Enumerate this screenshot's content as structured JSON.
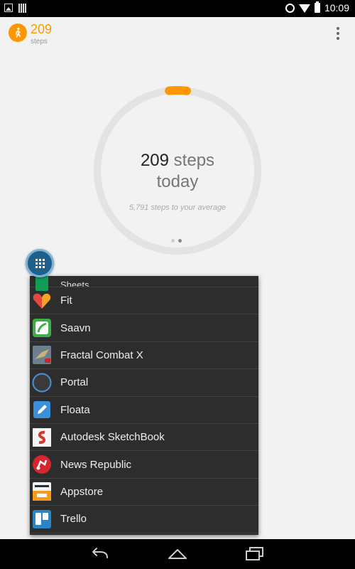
{
  "status_bar": {
    "time": "10:09",
    "icons": [
      "image-icon",
      "barcode-icon",
      "alarm-icon",
      "wifi-icon",
      "battery-icon"
    ]
  },
  "header": {
    "steps_value": "209",
    "steps_label": "steps",
    "accent_color": "#ff9800"
  },
  "ring": {
    "steps_number": "209",
    "steps_unit": "steps",
    "period": "today",
    "subtitle": "5,791 steps to your average",
    "progress_fraction": 0.035,
    "track_color": "#e3e3e3",
    "progress_color": "#ff9800"
  },
  "pager": {
    "pages": 2,
    "active_index": 1
  },
  "launcher": {
    "icon": "grid-icon",
    "apps": [
      {
        "name": "Sheets",
        "icon": "sheets-icon",
        "color": "#0f9d58",
        "partial": true
      },
      {
        "name": "Fit",
        "icon": "heart-icon",
        "color": "#e8453c"
      },
      {
        "name": "Saavn",
        "icon": "saavn-icon",
        "color": "#3fae49"
      },
      {
        "name": "Fractal Combat X",
        "icon": "jet-icon",
        "color": "#6b7f8e"
      },
      {
        "name": "Portal",
        "icon": "portal-icon",
        "color": "#4a90d9"
      },
      {
        "name": "Floata",
        "icon": "pencil-icon",
        "color": "#3b8fdb"
      },
      {
        "name": "Autodesk SketchBook",
        "icon": "sketchbook-icon",
        "color": "#d13b2f"
      },
      {
        "name": "News Republic",
        "icon": "news-icon",
        "color": "#d7262d"
      },
      {
        "name": "Appstore",
        "icon": "amazon-icon",
        "color": "#232f3e"
      },
      {
        "name": "Trello",
        "icon": "trello-icon",
        "color": "#2a85c7"
      }
    ]
  },
  "nav_bar": {
    "buttons": [
      "back-icon",
      "home-icon",
      "recents-icon"
    ]
  }
}
